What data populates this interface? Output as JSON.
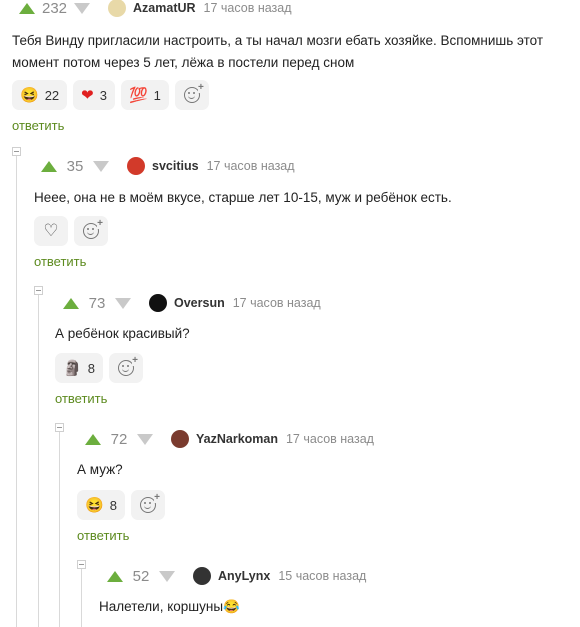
{
  "comments": [
    {
      "score": "232",
      "user": "AzamatUR",
      "time": "17 часов назад",
      "text": "Тебя Винду пригласили настроить, а ты начал мозги ебать хозяйке. Вспомнишь этот момент потом через 5 лет, лёжа в постели перед сном",
      "reactions": [
        {
          "emoji": "😆",
          "count": "22"
        },
        {
          "emoji": "❤",
          "count": "3"
        },
        {
          "emoji": "💯",
          "count": "1"
        }
      ],
      "reply": "ответить",
      "avatar_color": "#e8d9a8"
    },
    {
      "score": "35",
      "user": "svcitius",
      "time": "17 часов назад",
      "text": "Неее, она не в моём вкусе, старше лет 10-15, муж и ребёнок есть.",
      "reactions": [],
      "reply": "ответить",
      "avatar_color": "#d23a2a"
    },
    {
      "score": "73",
      "user": "Oversun",
      "time": "17 часов назад",
      "text": "А ребёнок красивый?",
      "reactions": [
        {
          "emoji": "🗿",
          "count": "8"
        }
      ],
      "reply": "ответить",
      "avatar_color": "#111111"
    },
    {
      "score": "72",
      "user": "YazNarkoman",
      "time": "17 часов назад",
      "text": "А муж?",
      "reactions": [
        {
          "emoji": "😆",
          "count": "8"
        }
      ],
      "reply": "ответить",
      "avatar_color": "#7a3b2e"
    },
    {
      "score": "52",
      "user": "AnyLynx",
      "time": "15 часов назад",
      "text": "Налетели, коршуны😂",
      "reactions": [],
      "reply": "",
      "avatar_color": "#333333"
    }
  ],
  "icons": {
    "upvote": "upvote-arrow-icon",
    "downvote": "downvote-arrow-icon",
    "add_reaction": "add-reaction-icon",
    "like": "heart-outline-icon",
    "collapse": "collapse-thread-icon"
  },
  "colors": {
    "upvote": "#6cae3e",
    "reply_link": "#5c8a1e",
    "score": "#8b8b8b"
  }
}
